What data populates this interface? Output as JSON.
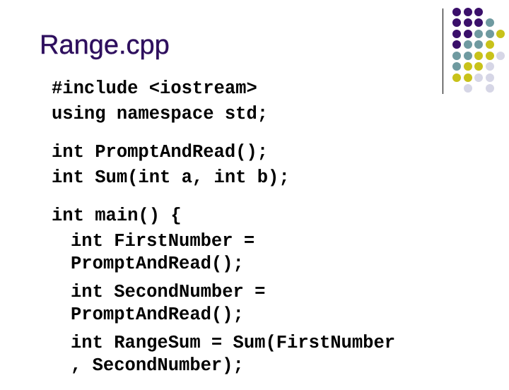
{
  "slide": {
    "title": "Range.cpp",
    "code_groups": [
      {
        "lines": [
          {
            "text": "#include <iostream>",
            "indent": 0
          },
          {
            "text": "using namespace std;",
            "indent": 0
          }
        ]
      },
      {
        "lines": [
          {
            "text": "int PromptAndRead();",
            "indent": 0
          },
          {
            "text": "int Sum(int a, int b);",
            "indent": 0
          }
        ]
      },
      {
        "lines": [
          {
            "text": "int main() {",
            "indent": 0
          },
          {
            "text": "int FirstNumber =",
            "indent": 1
          },
          {
            "text": "PromptAndRead();",
            "indent": 1
          },
          {
            "text": "int SecondNumber =",
            "indent": 1
          },
          {
            "text": "PromptAndRead();",
            "indent": 1
          },
          {
            "text": "int RangeSum = Sum(FirstNumber",
            "indent": 1
          },
          {
            "text": ", SecondNumber);",
            "indent": 1
          }
        ]
      }
    ]
  },
  "decoration": {
    "colors": {
      "P": "#3a0f6a",
      "T": "#6f9aa0",
      "Y": "#c8c21a",
      "L": "#d6d6e6"
    },
    "dot_grid": [
      "PPP..",
      "PPPT.",
      "PPTTY",
      "PTTY.",
      "TTYYL",
      "TYYL.",
      "YYLL.",
      ".L.L."
    ]
  }
}
